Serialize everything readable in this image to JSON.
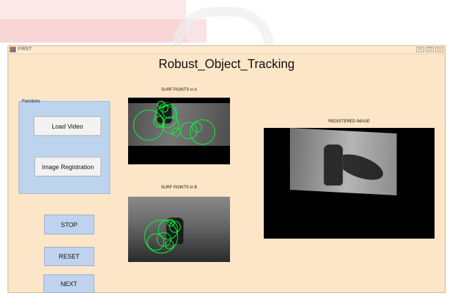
{
  "window": {
    "title": "FIRST",
    "controls": {
      "minimize": "▭",
      "maximize": "▢",
      "close": "▭"
    }
  },
  "main_title": "Robust_Object_Tracking",
  "functions_panel": {
    "title": "Functions",
    "load_video_label": "Load Video",
    "image_registration_label": "Image Registration"
  },
  "buttons": {
    "stop_label": "STOP",
    "reset_label": "RESET",
    "next_label": "NEXT"
  },
  "axes": {
    "surf_a_title": "SURF POINTS in A",
    "surf_b_title": "SURF POINTS in B",
    "registered_title": "REGISTERED IMAGE"
  },
  "colors": {
    "window_bg": "#fde6c8",
    "panel_bg": "#bdd4ef",
    "feature_marker": "#00ff33"
  }
}
